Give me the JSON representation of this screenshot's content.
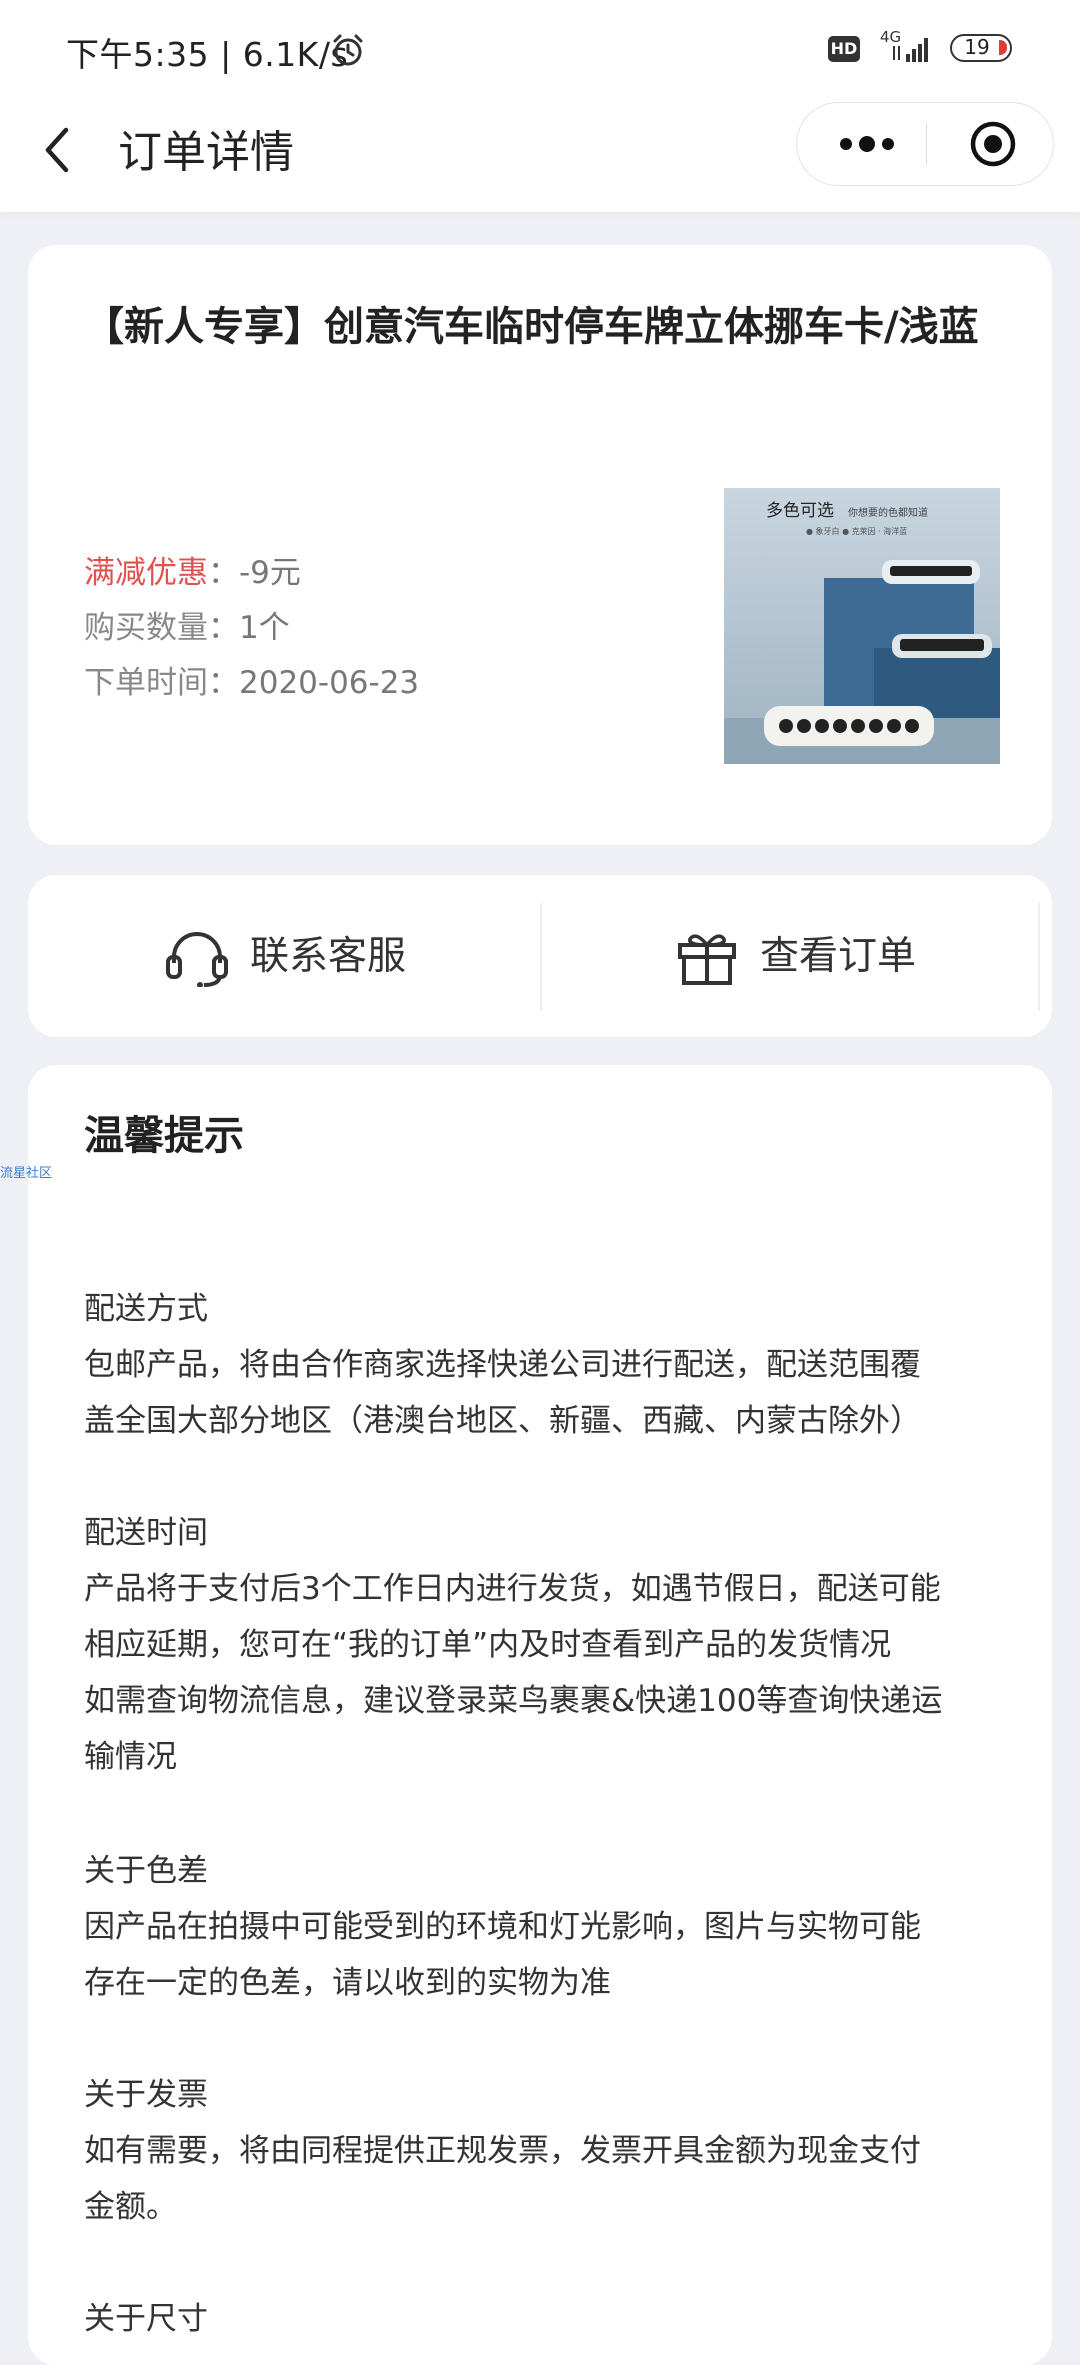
{
  "status_bar": {
    "time": "下午5:35 | 6.1K/s",
    "hd": "HD",
    "network": "4G",
    "battery": "19",
    "battery_color": "#e03a3a"
  },
  "nav": {
    "title": "订单详情",
    "back_icon": "back-arrow-icon",
    "more_icon": "more-dots-icon",
    "close_icon": "close-target-icon"
  },
  "product": {
    "title": "【新人专享】创意汽车临时停车牌立体挪车卡/浅蓝",
    "discount_label": "满减优惠",
    "discount_value": "：-9元",
    "quantity_label": "购买数量",
    "quantity_value": "：1个",
    "order_time_label": "下单时间",
    "order_time_value": "：2020-06-23",
    "image_caption": "多色可选",
    "image_caption2": "你想要的色都知道",
    "image_colors": "● 象牙白 ● 克莱因 · 海洋蓝",
    "discount_color": "#e0524d"
  },
  "actions": {
    "contact_label": "联系客服",
    "contact_icon": "headset-icon",
    "order_label": "查看订单",
    "order_icon": "gift-box-icon"
  },
  "tips": {
    "title": "温馨提示",
    "sections": [
      {
        "heading": "配送方式",
        "lines": [
          "包邮产品，将由合作商家选择快递公司进行配送，配送范围覆",
          "盖全国大部分地区（港澳台地区、新疆、西藏、内蒙古除外）"
        ]
      },
      {
        "heading": "配送时间",
        "lines": [
          "产品将于支付后3个工作日内进行发货，如遇节假日，配送可能",
          "相应延期，您可在“我的订单”内及时查看到产品的发货情况",
          "如需查询物流信息，建议登录菜鸟裹裹&快递100等查询快递运",
          "输情况"
        ]
      },
      {
        "heading": "关于色差",
        "lines": [
          "因产品在拍摄中可能受到的环境和灯光影响，图片与实物可能",
          "存在一定的色差，请以收到的实物为准"
        ]
      },
      {
        "heading": "关于发票",
        "lines": [
          "如有需要，将由同程提供正规发票，发票开具金额为现金支付",
          "金额。"
        ]
      },
      {
        "heading": "关于尺寸",
        "lines": []
      }
    ]
  },
  "watermark": "流星社区"
}
